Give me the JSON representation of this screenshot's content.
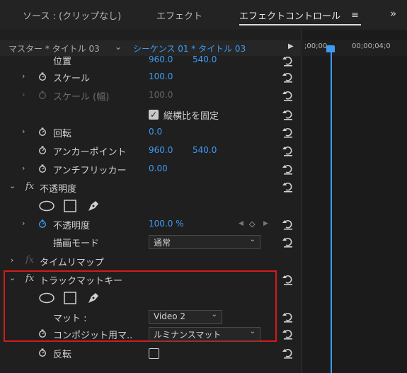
{
  "tabs": [
    {
      "label": "ソース : (クリップなし)",
      "active": false
    },
    {
      "label": "エフェクト",
      "active": false
    },
    {
      "label": "エフェクトコントロール",
      "active": true
    }
  ],
  "seq": {
    "master": "マスター * タイトル 03",
    "sequence": "シーケンス 01 * タイトル 03"
  },
  "timeline": {
    "t0": ";00;00",
    "t1": "00;00;04;0"
  },
  "rows": {
    "position": {
      "label": "位置",
      "v1": "960.0",
      "v2": "540.0"
    },
    "scale": {
      "label": "スケール",
      "v1": "100.0"
    },
    "scale_w": {
      "label": "スケール (幅)",
      "v1": "100.0"
    },
    "uniform": {
      "label": "縦横比を固定"
    },
    "rotation": {
      "label": "回転",
      "v1": "0.0"
    },
    "anchor": {
      "label": "アンカーポイント",
      "v1": "960.0",
      "v2": "540.0"
    },
    "antiflicker": {
      "label": "アンチフリッカー",
      "v1": "0.00"
    },
    "opacity_fx": {
      "label": "不透明度"
    },
    "opacity": {
      "label": "不透明度",
      "v1": "100.0 %"
    },
    "blend": {
      "label": "描画モード",
      "value": "通常"
    },
    "timeremap": {
      "label": "タイムリマップ"
    },
    "trackmatte": {
      "label": "トラックマットキー"
    },
    "matte": {
      "label": "マット :",
      "value": "Video 2"
    },
    "composite": {
      "label": "コンポジット用マ..",
      "value": "ルミナンスマット"
    },
    "reverse": {
      "label": "反転"
    }
  },
  "colors": {
    "accent": "#3d9bf4",
    "highlight": "#d61a1a"
  }
}
